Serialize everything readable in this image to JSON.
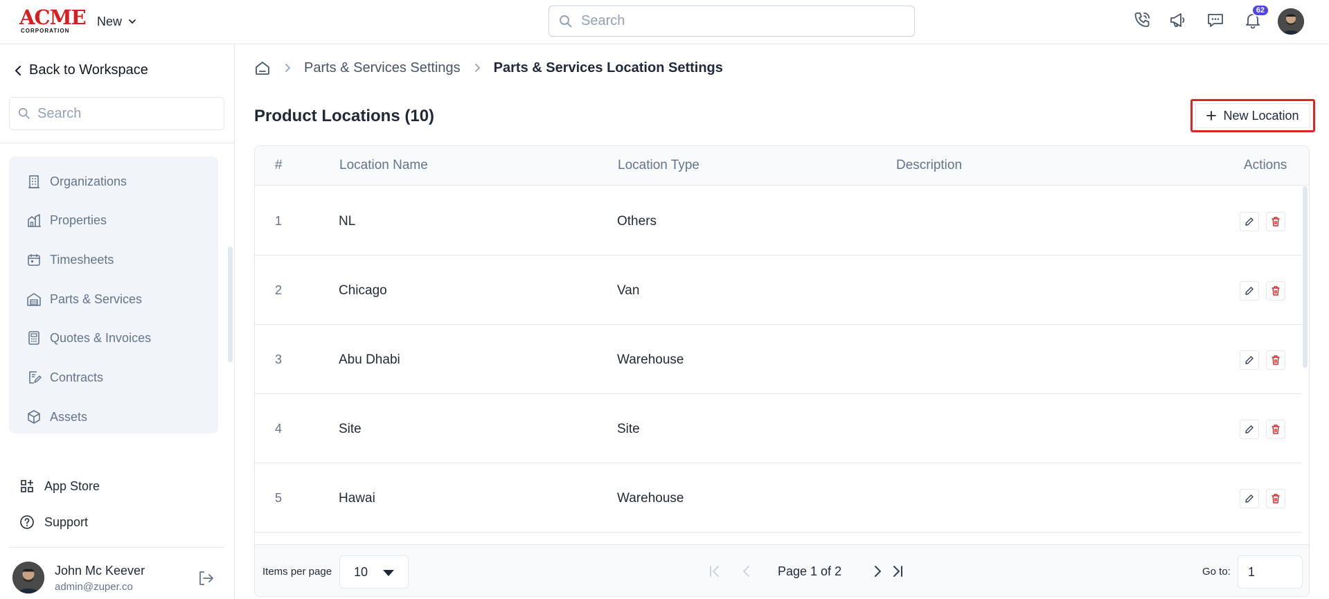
{
  "header": {
    "logo_text": "ACME",
    "logo_subtext": "CORPORATION",
    "new_label": "New",
    "search_placeholder": "Search",
    "notification_count": "62",
    "icons": [
      "phone-icon",
      "megaphone-icon",
      "chat-icon",
      "bell-icon"
    ]
  },
  "sidebar": {
    "back_label": "Back to Workspace",
    "search_placeholder": "Search",
    "items": [
      {
        "label": "Organizations",
        "icon": "building-icon"
      },
      {
        "label": "Properties",
        "icon": "properties-icon"
      },
      {
        "label": "Timesheets",
        "icon": "calendar-icon"
      },
      {
        "label": "Parts & Services",
        "icon": "warehouse-icon"
      },
      {
        "label": "Quotes & Invoices",
        "icon": "calculator-icon"
      },
      {
        "label": "Contracts",
        "icon": "contract-icon"
      },
      {
        "label": "Assets",
        "icon": "cube-icon"
      }
    ],
    "app_store_label": "App Store",
    "support_label": "Support",
    "user": {
      "name": "John Mc Keever",
      "email": "admin@zuper.co"
    }
  },
  "breadcrumb": {
    "parent": "Parts & Services Settings",
    "current": "Parts & Services Location Settings"
  },
  "page": {
    "title": "Product Locations (10)",
    "new_button_label": "New Location"
  },
  "table": {
    "columns": [
      "#",
      "Location Name",
      "Location Type",
      "Description",
      "Actions"
    ],
    "rows": [
      {
        "num": "1",
        "name": "NL",
        "type": "Others",
        "description": ""
      },
      {
        "num": "2",
        "name": "Chicago",
        "type": "Van",
        "description": ""
      },
      {
        "num": "3",
        "name": "Abu Dhabi",
        "type": "Warehouse",
        "description": ""
      },
      {
        "num": "4",
        "name": "Site",
        "type": "Site",
        "description": ""
      },
      {
        "num": "5",
        "name": "Hawai",
        "type": "Warehouse",
        "description": ""
      }
    ]
  },
  "pagination": {
    "items_per_page_label": "Items per page",
    "items_per_page_value": "10",
    "page_text": "Page 1 of 2",
    "goto_label": "Go to:",
    "goto_value": "1"
  },
  "colors": {
    "accent_red": "#dc2626",
    "badge_indigo": "#4f46e5",
    "nav_bg": "#f1f5f9"
  }
}
